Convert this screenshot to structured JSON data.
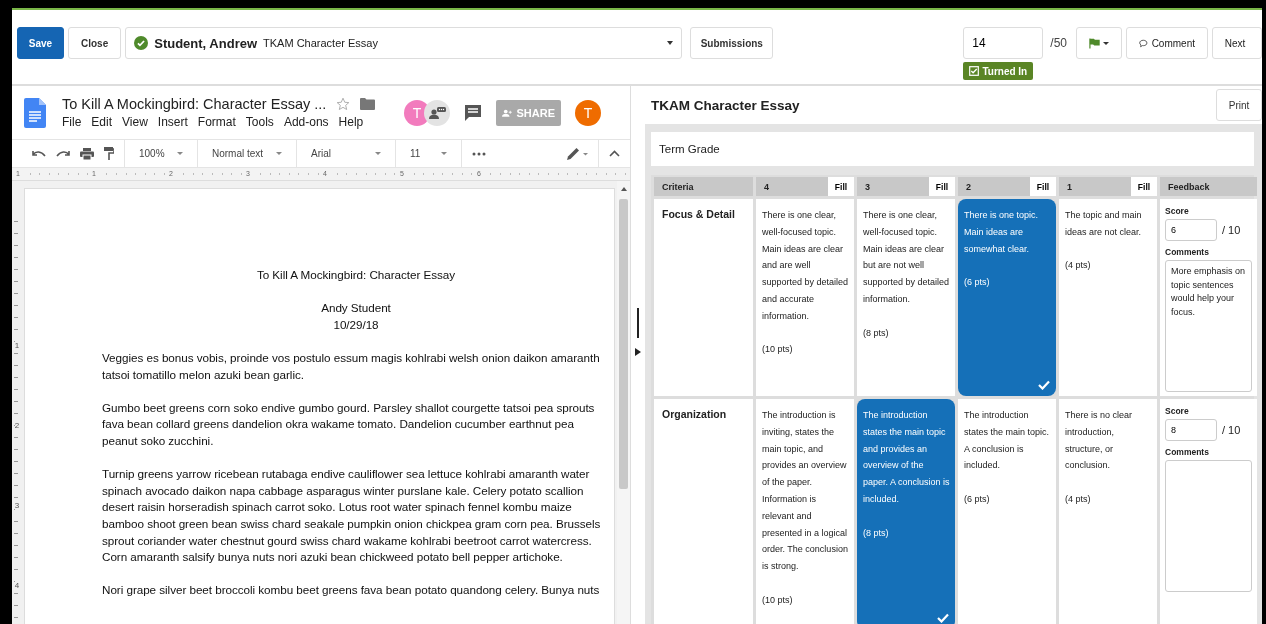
{
  "header": {
    "save": "Save",
    "close": "Close",
    "student": {
      "name": "Student, Andrew",
      "assignment": "TKAM Character Essay"
    },
    "submissions": "Submissions",
    "score": {
      "value": "14",
      "total": "/50"
    },
    "status": "Turned In",
    "comment": "Comment",
    "next": "Next"
  },
  "doc": {
    "title": "To Kill A Mockingbird: Character Essay ...",
    "menu": [
      "File",
      "Edit",
      "View",
      "Insert",
      "Format",
      "Tools",
      "Add-ons",
      "Help"
    ],
    "avatars": [
      {
        "letter": "T",
        "color": "#f27bbd"
      },
      {
        "letter": "T",
        "color": "#ef6c00"
      }
    ],
    "share": "SHARE",
    "toolbar": {
      "zoom": "100%",
      "style": "Normal text",
      "font": "Arial",
      "size": "11"
    },
    "ruler": [
      "1",
      "1",
      "2",
      "3",
      "4",
      "5",
      "6"
    ],
    "vertical_ruler": [
      "1",
      "2",
      "3",
      "4"
    ],
    "heading": "To Kill A Mockingbird: Character Essay",
    "author": "Andy Student",
    "date": "10/29/18",
    "paragraphs": [
      "Veggies es bonus vobis, proinde vos postulo essum magis kohlrabi welsh onion daikon amaranth tatsoi tomatillo melon azuki bean garlic.",
      "Gumbo beet greens corn soko endive gumbo gourd. Parsley shallot courgette tatsoi pea sprouts fava bean collard greens dandelion okra wakame tomato. Dandelion cucumber earthnut pea peanut soko zucchini.",
      "Turnip greens yarrow ricebean rutabaga endive cauliflower sea lettuce kohlrabi amaranth water spinach avocado daikon napa cabbage asparagus winter purslane kale. Celery potato scallion desert raisin horseradish spinach carrot soko. Lotus root water spinach fennel kombu maize bamboo shoot green bean swiss chard seakale pumpkin onion chickpea gram corn pea. Brussels sprout coriander water chestnut gourd swiss chard wakame kohlrabi beetroot carrot watercress. Corn amaranth salsify bunya nuts nori azuki bean chickweed potato bell pepper artichoke.",
      "Nori grape silver beet broccoli kombu beet greens fava bean potato quandong celery. Bunya nuts"
    ]
  },
  "rubric": {
    "title": "TKAM Character Essay",
    "print": "Print",
    "term_grade": "Term Grade",
    "columns": [
      {
        "label": "Criteria"
      },
      {
        "label": "4",
        "fill": "Fill"
      },
      {
        "label": "3",
        "fill": "Fill"
      },
      {
        "label": "2",
        "fill": "Fill"
      },
      {
        "label": "1",
        "fill": "Fill"
      },
      {
        "label": "Feedback"
      }
    ],
    "rows": [
      {
        "criterion": "Focus & Detail",
        "ratings": [
          {
            "text": "There is one clear, well-focused topic. Main ideas are clear and are well supported by detailed and accurate information.",
            "points": "(10 pts)",
            "selected": false
          },
          {
            "text": "There is one clear, well-focused topic. Main ideas are clear but are not well supported by detailed information.",
            "points": "(8 pts)",
            "selected": false
          },
          {
            "text": "There is one topic. Main ideas are somewhat clear.",
            "points": "(6 pts)",
            "selected": true
          },
          {
            "text": "The topic and main ideas are not clear.",
            "points": "(4 pts)",
            "selected": false
          }
        ],
        "score_label": "Score",
        "score": "6",
        "total": "/ 10",
        "comments_label": "Comments",
        "comment": "More emphasis on topic sentences would help your focus."
      },
      {
        "criterion": "Organization",
        "ratings": [
          {
            "text": "The introduction is inviting, states the main topic, and provides an overview of the paper. Information is relevant and presented in a logical order. The conclusion is strong.",
            "points": "(10 pts)",
            "selected": false
          },
          {
            "text": "The introduction states the main topic and provides an overview of the paper. A conclusion is included.",
            "points": "(8 pts)",
            "selected": true
          },
          {
            "text": "The introduction states the main topic. A conclusion is included.",
            "points": "(6 pts)",
            "selected": false
          },
          {
            "text": "There is no clear introduction, structure, or conclusion.",
            "points": "(4 pts)",
            "selected": false
          }
        ],
        "score_label": "Score",
        "score": "8",
        "total": "/ 10",
        "comments_label": "Comments"
      }
    ]
  }
}
